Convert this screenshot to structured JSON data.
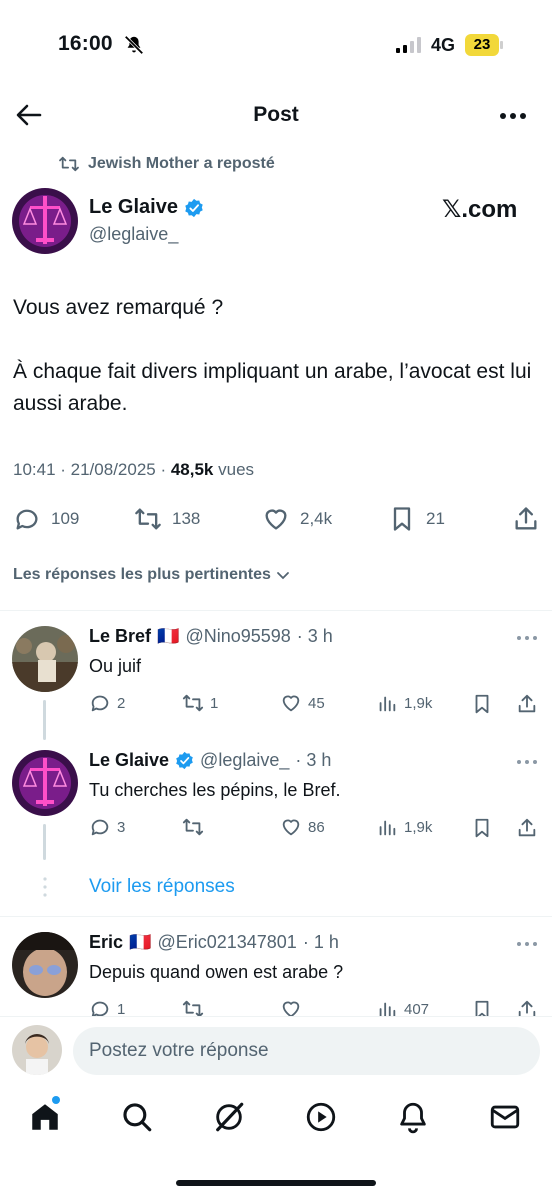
{
  "status_bar": {
    "time": "16:00",
    "network": "4G",
    "battery": "23"
  },
  "header": {
    "title": "Post"
  },
  "repost": {
    "text": "Jewish Mother a reposté"
  },
  "post": {
    "author_name": "Le Glaive",
    "author_handle": "@leglaive_",
    "source_label": "𝕏.com",
    "paragraph_1": "Vous avez remarqué ?",
    "paragraph_2": "À chaque fait divers impliquant un arabe, l’avocat est lui aussi arabe.",
    "timestamp": "10:41 · 21/08/2025 · ",
    "views_count": "48,5k",
    "views_label": " vues",
    "replies": "109",
    "reposts": "138",
    "likes": "2,4k",
    "bookmarks": "21"
  },
  "replies_filter": {
    "label": "Les réponses les plus pertinentes"
  },
  "replies": [
    {
      "name": "Le Bref",
      "flag": "🇫🇷",
      "handle": "@Nino95598",
      "time": "· 3 h",
      "text": "Ou juif",
      "replies": "2",
      "reposts": "1",
      "likes": "45",
      "views": "1,9k"
    },
    {
      "name": "Le Glaive",
      "flag": "",
      "handle": "@leglaive_",
      "time": "· 3 h",
      "text": "Tu cherches les pépins, le Bref.",
      "replies": "3",
      "reposts": "",
      "likes": "86",
      "views": "1,9k"
    },
    {
      "name": "Eric",
      "flag": "🇫🇷",
      "handle": "@Eric021347801",
      "time": "· 1 h",
      "text": "Depuis quand owen est arabe ?",
      "replies": "1",
      "reposts": "",
      "likes": "",
      "views": "407"
    }
  ],
  "show_replies": {
    "label": "Voir les réponses"
  },
  "compose": {
    "placeholder": "Postez votre réponse"
  },
  "colors": {
    "accent": "#1d9bf0",
    "text": "#0f1419",
    "muted": "#536471"
  }
}
